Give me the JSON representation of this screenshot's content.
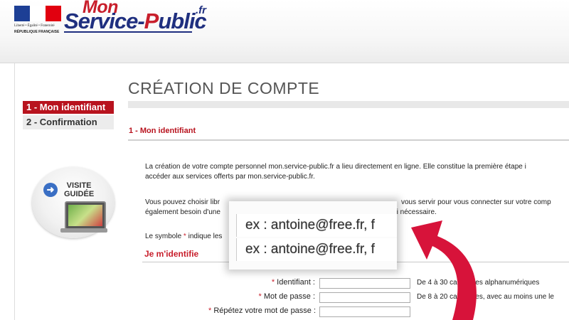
{
  "header": {
    "gov_logo_motto": "Liberté • Égalité • Fraternité",
    "gov_logo_country": "RÉPUBLIQUE FRANÇAISE",
    "brand_mon": "Mon",
    "brand_service": "Service-",
    "brand_p": "P",
    "brand_ublic": "ublic",
    "brand_fr": ".fr"
  },
  "steps": [
    {
      "label": "1 - Mon identifiant",
      "active": true
    },
    {
      "label": "2 - Confirmation",
      "active": false
    }
  ],
  "visite": {
    "line1": "VISITE",
    "line2": "GUIDÉE",
    "icon": "arrow-right-icon"
  },
  "page": {
    "title": "CRÉATION DE COMPTE",
    "section_heading": "1 - Mon identifiant",
    "intro_line1": "La création de votre compte personnel mon.service-public.fr a lieu directement en ligne. Elle constitue la première étape i",
    "intro_line2": "accéder aux services offerts par mon.service-public.fr.",
    "choose_left1": "Vous pouvez choisir libr",
    "choose_left2": "également besoin d'une",
    "choose_right1": "vous servir pour vous connecter sur votre comp",
    "choose_right2": "er si nécessaire.",
    "symbol_prefix": "Le symbole ",
    "symbol_star": "*",
    "symbol_suffix": " indique les",
    "identify_heading": "Je m'identifie"
  },
  "form": {
    "fields": [
      {
        "label": "Identifiant :",
        "hint": "De 4 à 30 caractères alphanumériques",
        "value": ""
      },
      {
        "label": "Mot de passe :",
        "hint": "De 8 à 20 caractères, avec au moins une le",
        "value": ""
      },
      {
        "label": "Répétez votre mot de passe :",
        "hint": "",
        "value": ""
      }
    ]
  },
  "zoom": {
    "example1": "ex : antoine@free.fr, f",
    "example2": "ex : antoine@free.fr, f"
  },
  "colors": {
    "accent_red": "#b8131e",
    "brand_blue": "#1f2f7f",
    "arrow_red": "#d7133a"
  }
}
